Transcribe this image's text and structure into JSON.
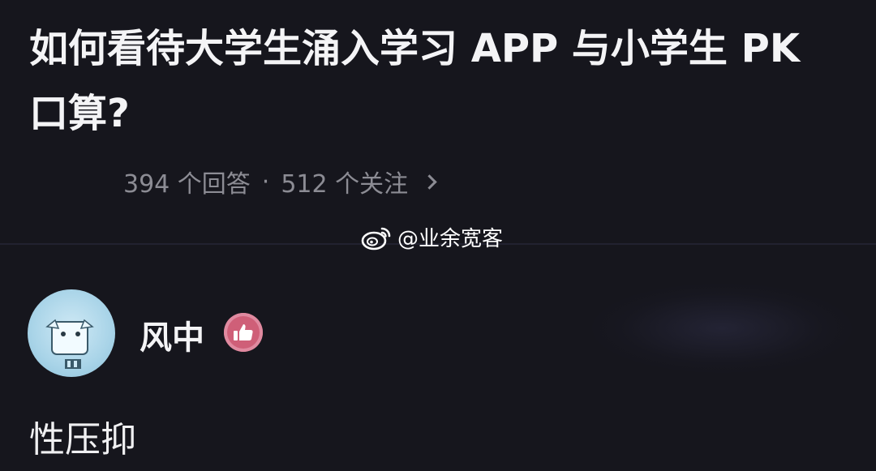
{
  "question": {
    "title": "如何看待大学生涌入学习 APP 与小学生 PK 口算?",
    "answer_count": "394 个回答",
    "separator": "·",
    "follower_count": "512 个关注"
  },
  "watermark": {
    "text": "@业余宽客",
    "icon": "weibo-icon"
  },
  "answer": {
    "author_name": "风中",
    "badge_icon": "thumbs-up-icon",
    "content": "性压抑"
  },
  "colors": {
    "background": "#16161d",
    "text_primary": "#f4f4f6",
    "text_secondary": "#8c8c94",
    "badge": "#cf5f78"
  }
}
